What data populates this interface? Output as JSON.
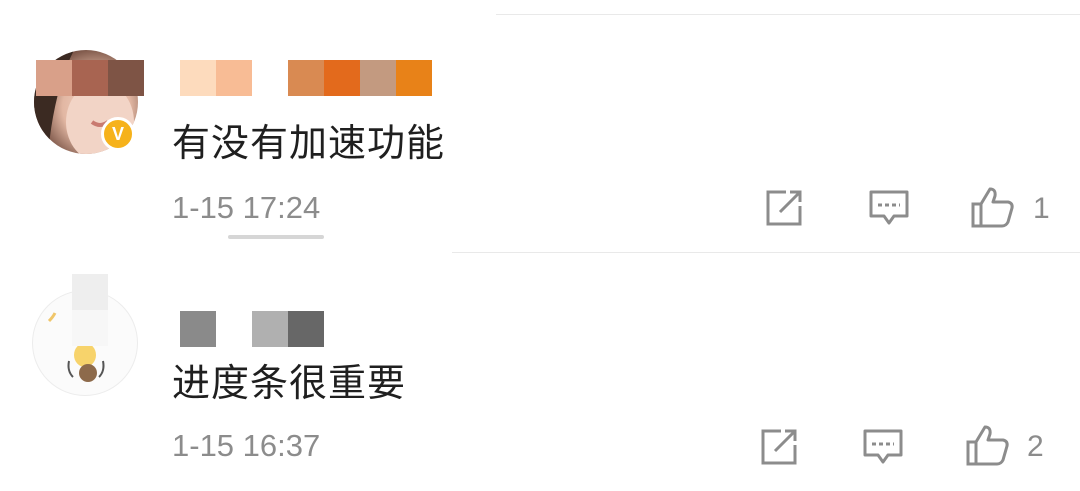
{
  "comments": [
    {
      "username_masked": "",
      "text": "有没有加速功能",
      "time": "1-15 17:24",
      "like_count": "1",
      "verified_badge": "V",
      "avatar_icon": "user-avatar-portrait",
      "mosaic_colors": [
        "#fddbbd",
        "#f8bc95",
        "#d98a52",
        "#e36a1c",
        "#c39a80",
        "#e88218"
      ],
      "avatar_mosaic_colors": [
        "#d9a089",
        "#a86451",
        "#7e5445"
      ]
    },
    {
      "username_masked": "",
      "text": "进度条很重要",
      "time": "1-15 16:37",
      "like_count": "2",
      "avatar_icon": "user-avatar-lightbulb",
      "mosaic_colors": [
        "#8a8a8a",
        "#b0b0b0",
        "#676767"
      ],
      "avatar_mosaic_colors": [
        "#eeeeee",
        "#f7f7f7"
      ]
    }
  ],
  "icons": {
    "share": "share-icon",
    "reply": "comment-icon",
    "like": "thumbs-up-icon"
  },
  "colors": {
    "text": "#1f1f1f",
    "meta": "#8c8c8c",
    "badge": "#f6b21b",
    "divider": "#e9e9e9"
  }
}
